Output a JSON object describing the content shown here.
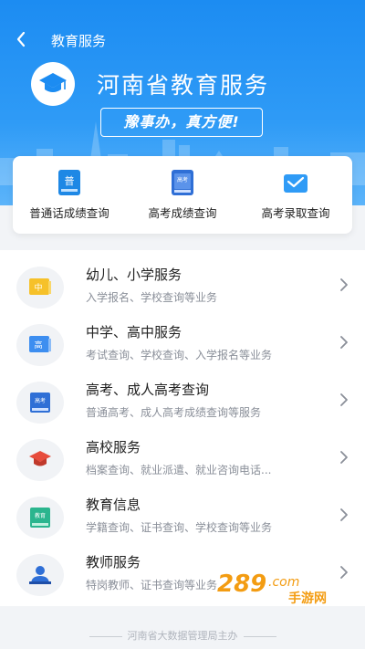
{
  "topbar": {
    "back_icon": "chevron-left-icon",
    "title": "教育服务"
  },
  "banner": {
    "logo_icon": "graduation-cap-icon",
    "brand": "河南省教育服务",
    "slogan": "豫事办，真方便!"
  },
  "quick_services": [
    {
      "label": "普通话成绩查询",
      "icon": "putonghua-book-icon",
      "icon_text": "普",
      "color": "#1e88e5"
    },
    {
      "label": "高考成绩查询",
      "icon": "gaokao-book-icon",
      "icon_text": "高考",
      "color": "#2f6fd6"
    },
    {
      "label": "高考录取查询",
      "icon": "envelope-icon",
      "color": "#2f9bf6"
    }
  ],
  "services": [
    {
      "title": "幼儿、小学服务",
      "subtitle": "入学报名、学校查询等业务",
      "icon": "primary-school-icon",
      "icon_text": "中",
      "color": "#f6c12a"
    },
    {
      "title": "中学、高中服务",
      "subtitle": "考试查询、学校查询、入学报名等业务",
      "icon": "high-school-icon",
      "icon_text": "高",
      "color": "#3d8ef0"
    },
    {
      "title": "高考、成人高考查询",
      "subtitle": "普通高考、成人高考成绩查询等服务",
      "icon": "gaokao-icon",
      "icon_text": "高考",
      "color": "#2f6fd6"
    },
    {
      "title": "高校服务",
      "subtitle": "档案查询、就业派遣、就业咨询电话...",
      "icon": "university-cap-icon",
      "color": "#e74c3c"
    },
    {
      "title": "教育信息",
      "subtitle": "学籍查询、证书查询、学校查询等业务",
      "icon": "education-info-icon",
      "icon_text": "教育",
      "color": "#2bb58e"
    },
    {
      "title": "教师服务",
      "subtitle": "特岗教师、证书查询等业务",
      "icon": "teacher-icon",
      "color": "#2f6fd6"
    }
  ],
  "row_chevron_icon": "chevron-right-icon",
  "footer": "河南省大数据管理局主办",
  "watermark": {
    "text_main": "289",
    "text_suffix": ".com",
    "text_sub": "手游网"
  }
}
